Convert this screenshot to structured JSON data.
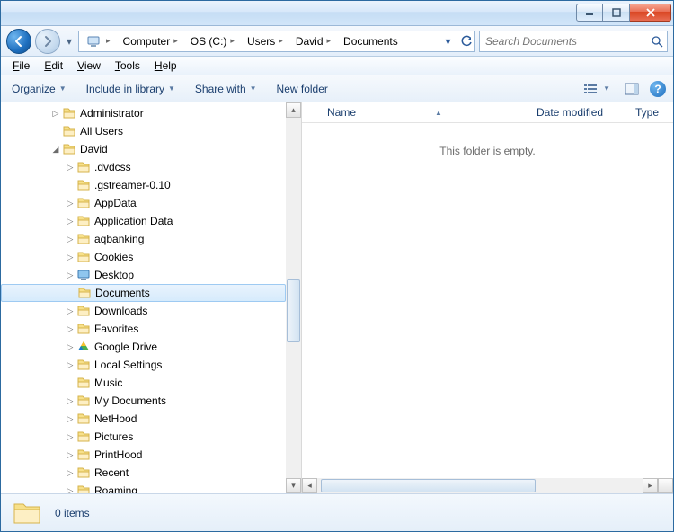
{
  "breadcrumbs": [
    "Computer",
    "OS (C:)",
    "Users",
    "David",
    "Documents"
  ],
  "search": {
    "placeholder": "Search Documents"
  },
  "menubar": [
    "File",
    "Edit",
    "View",
    "Tools",
    "Help"
  ],
  "toolbar": {
    "organize": "Organize",
    "include": "Include in library",
    "share": "Share with",
    "newfolder": "New folder"
  },
  "tree": {
    "items": [
      {
        "indent": 3,
        "expander": "▷",
        "icon": "folder",
        "label": "Administrator"
      },
      {
        "indent": 3,
        "expander": "",
        "icon": "folder",
        "label": "All Users"
      },
      {
        "indent": 3,
        "expander": "◢",
        "icon": "folder",
        "label": "David"
      },
      {
        "indent": 4,
        "expander": "▷",
        "icon": "folder",
        "label": ".dvdcss"
      },
      {
        "indent": 4,
        "expander": "",
        "icon": "folder",
        "label": ".gstreamer-0.10"
      },
      {
        "indent": 4,
        "expander": "▷",
        "icon": "folder",
        "label": "AppData"
      },
      {
        "indent": 4,
        "expander": "▷",
        "icon": "folder",
        "label": "Application Data"
      },
      {
        "indent": 4,
        "expander": "▷",
        "icon": "folder",
        "label": "aqbanking"
      },
      {
        "indent": 4,
        "expander": "▷",
        "icon": "folder",
        "label": "Cookies"
      },
      {
        "indent": 4,
        "expander": "▷",
        "icon": "desktop",
        "label": "Desktop"
      },
      {
        "indent": 4,
        "expander": "",
        "icon": "folder",
        "label": "Documents",
        "selected": true
      },
      {
        "indent": 4,
        "expander": "▷",
        "icon": "folder",
        "label": "Downloads"
      },
      {
        "indent": 4,
        "expander": "▷",
        "icon": "folder",
        "label": "Favorites"
      },
      {
        "indent": 4,
        "expander": "▷",
        "icon": "gdrive",
        "label": "Google Drive"
      },
      {
        "indent": 4,
        "expander": "▷",
        "icon": "folder",
        "label": "Local Settings"
      },
      {
        "indent": 4,
        "expander": "",
        "icon": "folder",
        "label": "Music"
      },
      {
        "indent": 4,
        "expander": "▷",
        "icon": "folder",
        "label": "My Documents"
      },
      {
        "indent": 4,
        "expander": "▷",
        "icon": "folder",
        "label": "NetHood"
      },
      {
        "indent": 4,
        "expander": "▷",
        "icon": "folder",
        "label": "Pictures"
      },
      {
        "indent": 4,
        "expander": "▷",
        "icon": "folder",
        "label": "PrintHood"
      },
      {
        "indent": 4,
        "expander": "▷",
        "icon": "folder",
        "label": "Recent"
      },
      {
        "indent": 4,
        "expander": "▷",
        "icon": "folder",
        "label": "Roaming"
      }
    ]
  },
  "columns": {
    "name": "Name",
    "modified": "Date modified",
    "type": "Type"
  },
  "empty_text": "This folder is empty.",
  "status": {
    "count": "0 items"
  },
  "colors": {
    "accent": "#1e6fbf",
    "selection": "#d6ebfc"
  }
}
